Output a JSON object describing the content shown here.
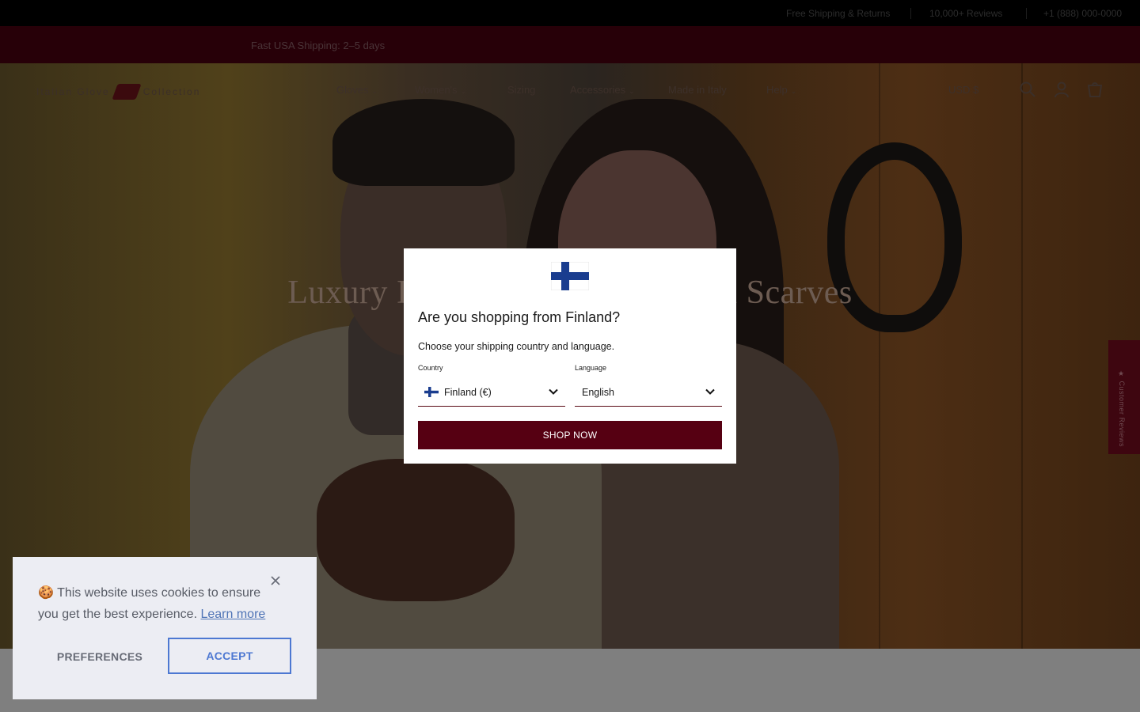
{
  "topbar": {
    "items": [
      "Free Shipping & Returns",
      "10,000+ Reviews",
      "+1 (888) 000-0000"
    ]
  },
  "promo": {
    "text": "Fast USA Shipping: 2–5 days"
  },
  "header": {
    "logo_left": "Italian Glove",
    "logo_right": "Collection",
    "nav": [
      {
        "label": "Gloves",
        "chevron": true
      },
      {
        "label": "Women's",
        "chevron": true
      },
      {
        "label": "Sizing",
        "chevron": false
      },
      {
        "label": "Accessories",
        "chevron": true
      },
      {
        "label": "Made in Italy",
        "chevron": false
      },
      {
        "label": "Help",
        "chevron": true
      }
    ],
    "currency": "USD $"
  },
  "hero": {
    "title": "Luxury Italian Leather Gloves & Scarves"
  },
  "side_tab": {
    "label": "★ Customer Reviews"
  },
  "modal": {
    "title": "Are you shopping from Finland?",
    "subtitle": "Choose your shipping country and language.",
    "country_label": "Country",
    "country_value": "Finland (€)",
    "language_label": "Language",
    "language_value": "English",
    "button": "SHOP NOW"
  },
  "cookie": {
    "emoji": "🍪",
    "message": "This website uses cookies to ensure you get the best experience.",
    "link": "Learn more",
    "preferences": "PREFERENCES",
    "accept": "ACCEPT"
  },
  "colors": {
    "brand": "#560012",
    "accept_blue": "#4d78d2",
    "cookie_bg": "#ecedf3",
    "finland_blue": "#1a3d8f"
  }
}
